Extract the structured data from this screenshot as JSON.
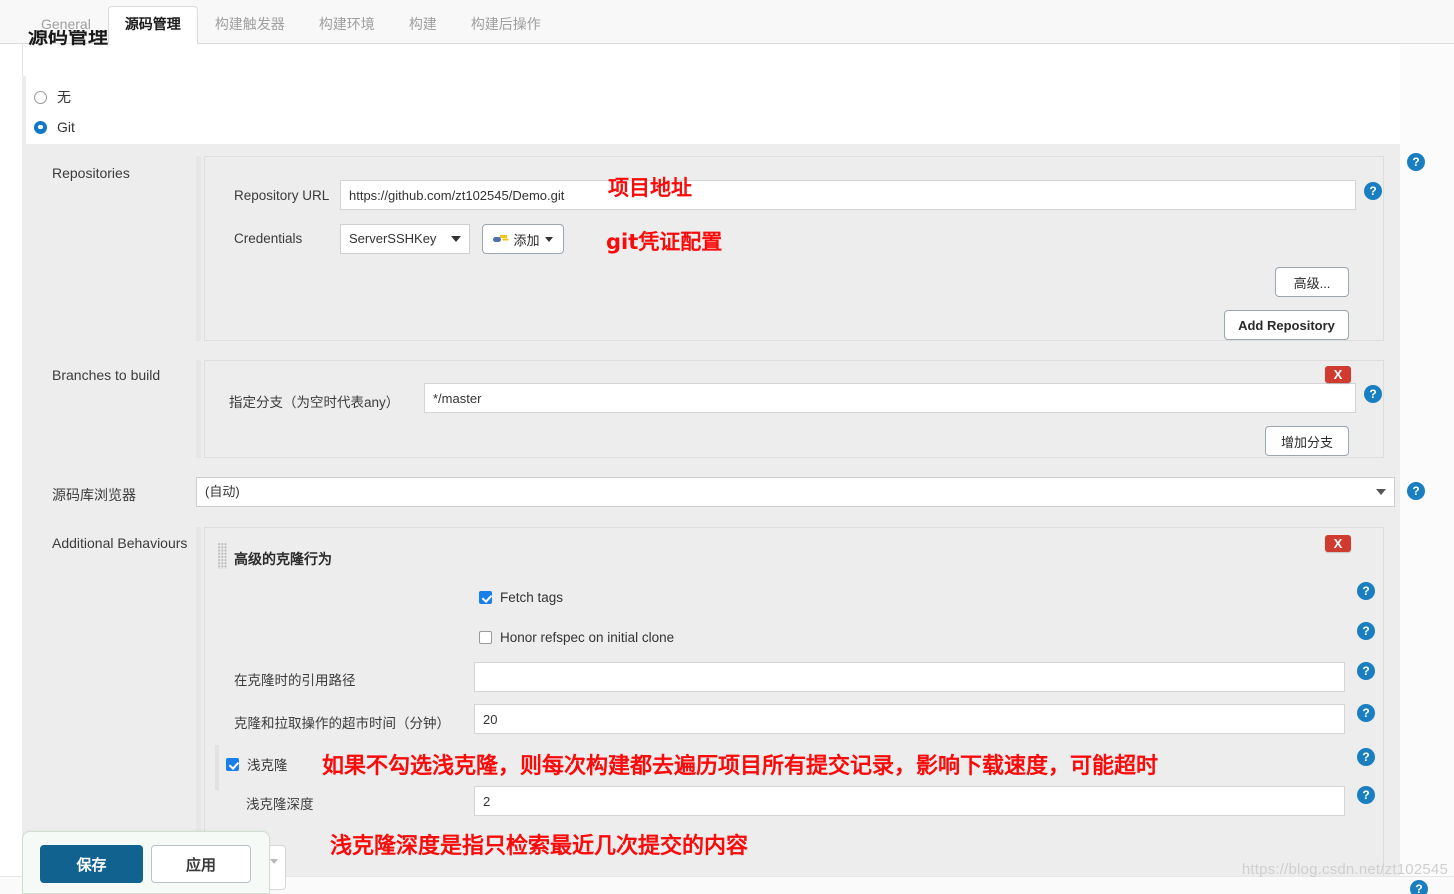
{
  "tabs": [
    {
      "label": "General",
      "active": false
    },
    {
      "label": "源码管理",
      "active": true
    },
    {
      "label": "构建触发器",
      "active": false
    },
    {
      "label": "构建环境",
      "active": false
    },
    {
      "label": "构建",
      "active": false
    },
    {
      "label": "构建后操作",
      "active": false
    }
  ],
  "section": {
    "title": "源码管理"
  },
  "scm_choice": {
    "none_label": "无",
    "git_label": "Git",
    "selected": "Git"
  },
  "repositories": {
    "label": "Repositories",
    "repository_url": {
      "label": "Repository URL",
      "value": "https://github.com/zt102545/Demo.git"
    },
    "credentials": {
      "label": "Credentials",
      "selected": "ServerSSHKey",
      "add_button": "添加",
      "add_icon": "key-icon",
      "caret_icon": "caret-down-icon"
    },
    "advanced_button": "高级...",
    "add_repository_button": "Add Repository"
  },
  "branches": {
    "label": "Branches to build",
    "branch_specifier": {
      "label": "指定分支（为空时代表any）",
      "value": "*/master"
    },
    "add_branch_button": "增加分支",
    "delete_button": "X"
  },
  "repository_browser": {
    "label": "源码库浏览器",
    "selected": "(自动)"
  },
  "additional_behaviours": {
    "label": "Additional Behaviours",
    "block_title": "高级的克隆行为",
    "delete_button": "X",
    "fetch_tags": {
      "label": "Fetch tags",
      "checked": true
    },
    "honor_refspec": {
      "label": "Honor refspec on initial clone",
      "checked": false
    },
    "reference_path": {
      "label": "在克隆时的引用路径",
      "value": ""
    },
    "timeout": {
      "label": "克隆和拉取操作的超市时间（分钟）",
      "value": "20"
    },
    "shallow_clone": {
      "label": "浅克隆",
      "checked": true
    },
    "shallow_depth": {
      "label": "浅克隆深度",
      "value": "2"
    }
  },
  "annotations": {
    "repo_url": "项目地址",
    "credentials": "git凭证配置",
    "shallow_clone": "如果不勾选浅克隆，则每次构建都去遍历项目所有提交记录，影响下载速度，可能超时",
    "shallow_depth": "浅克隆深度是指只检索最近几次提交的内容"
  },
  "save_bar": {
    "save_label": "保存",
    "apply_label": "应用"
  },
  "help_icon_glyph": "?",
  "watermark": "https://blog.csdn.net/zt102545",
  "colors": {
    "accent": "#1a7fc1",
    "danger": "#cf3b2e",
    "annotation": "#fb0a0a",
    "save_button": "#11628f"
  }
}
